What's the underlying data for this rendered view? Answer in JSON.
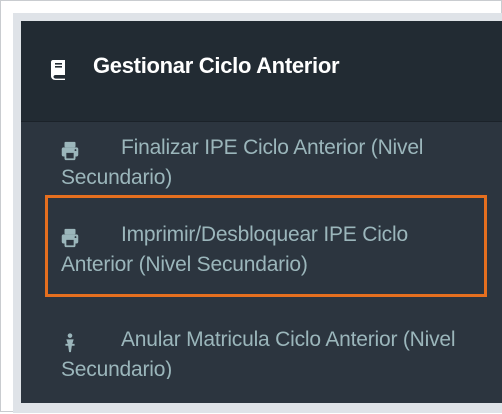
{
  "header": {
    "title": "Gestionar Ciclo Anterior",
    "icon": "book-icon"
  },
  "menu": {
    "items": [
      {
        "label": "Finalizar IPE Ciclo Anterior (Nivel Secundario)",
        "icon": "printer-icon"
      },
      {
        "label": "Imprimir/Desbloquear IPE Ciclo Anterior (Nivel Secundario)",
        "icon": "printer-icon",
        "highlight": "#e56f1f"
      },
      {
        "label": "Anular Matricula Ciclo Anterior (Nivel Secundario)",
        "icon": "user-icon"
      }
    ]
  },
  "colors": {
    "panel_bg": "#2c353f",
    "header_bg": "#222b33",
    "text_header": "#ffffff",
    "text_menu": "#9bb6bb",
    "highlight": "#e56f1f"
  }
}
